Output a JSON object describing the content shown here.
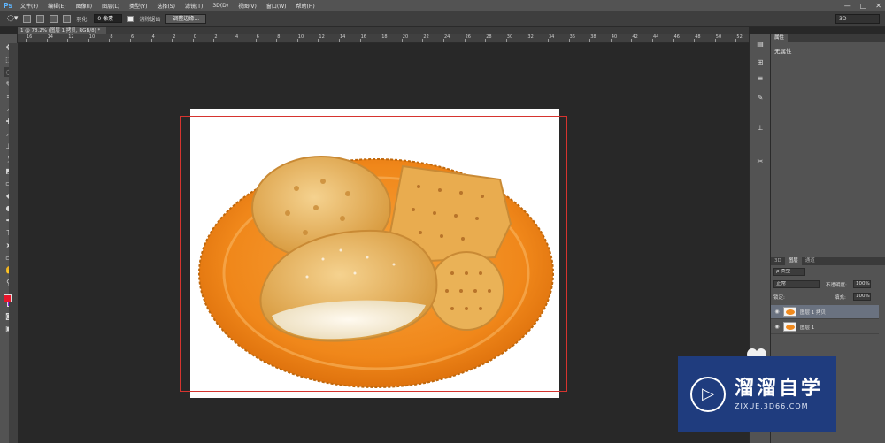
{
  "app": {
    "logo_text": "Ps"
  },
  "menubar": {
    "items": [
      "文件(F)",
      "编辑(E)",
      "图像(I)",
      "图层(L)",
      "类型(Y)",
      "选择(S)",
      "滤镜(T)",
      "3D(D)",
      "视图(V)",
      "窗口(W)",
      "帮助(H)"
    ],
    "window_controls": [
      "—",
      "□",
      "✕"
    ]
  },
  "options_bar": {
    "feather_label": "羽化:",
    "feather_value": "0 像素",
    "antialias_label": "消除锯齿",
    "refine_edge_label": "调整边缘...",
    "workspace_value": "3D"
  },
  "document": {
    "tab_title": "1 @ 78.2% (图层 1 拷贝, RGB/8) *",
    "ruler_ticks": [
      "16",
      "14",
      "12",
      "10",
      "8",
      "6",
      "4",
      "2",
      "0",
      "2",
      "4",
      "6",
      "8",
      "10",
      "12",
      "14",
      "16",
      "18",
      "20",
      "22",
      "24",
      "26",
      "28",
      "30",
      "32",
      "34",
      "36",
      "38",
      "40",
      "42",
      "44",
      "46",
      "48",
      "50",
      "52"
    ]
  },
  "properties_panel": {
    "tab_label": "属性",
    "body_text": "无属性"
  },
  "layers_panel": {
    "tabs": [
      "3D",
      "图层",
      "通道"
    ],
    "active_tab": "图层",
    "filter_label": "ρ 类型",
    "blend_mode": "正常",
    "opacity_label": "不透明度:",
    "opacity_value": "100%",
    "lock_label": "锁定:",
    "fill_label": "填充:",
    "fill_value": "100%",
    "layers": [
      {
        "name": "图层 1 拷贝",
        "selected": true
      },
      {
        "name": "图层 1",
        "selected": false
      }
    ]
  },
  "watermark": {
    "name": "溜溜自学",
    "url": "ZIXUE.3D66.COM"
  },
  "colors": {
    "foreground": "#e8162b",
    "background": "#8a1de8",
    "selection": "#d6342f",
    "plate": "#f08a1e",
    "watermark_bg": "#1f3c7e"
  }
}
